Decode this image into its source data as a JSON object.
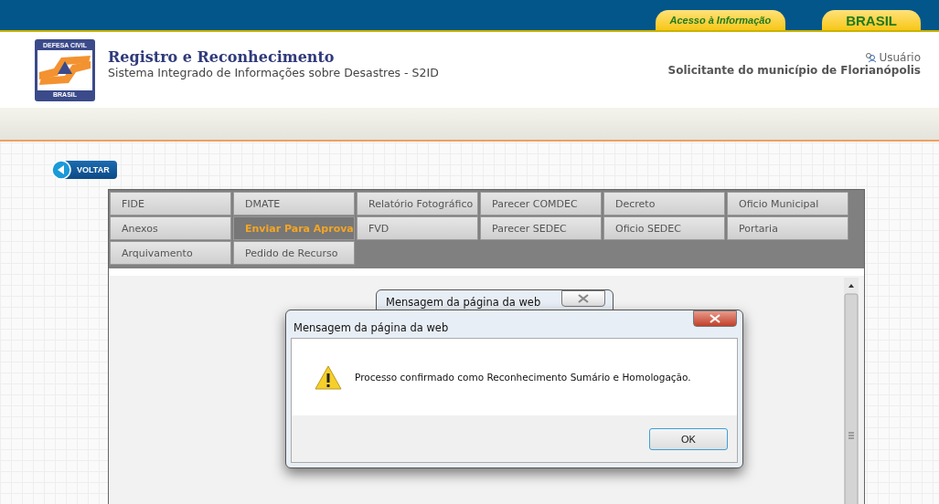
{
  "top_bar": {
    "links": [
      {
        "label": "Acesso à Informação",
        "kind": "access"
      },
      {
        "label": "BRASIL",
        "kind": "brasil"
      }
    ]
  },
  "header": {
    "logo": {
      "top": "DEFESA CIVIL",
      "bottom": "BRASIL"
    },
    "title": "Registro e Reconhecimento",
    "subtitle": "Sistema Integrado de Informações sobre Desastres - S2ID",
    "user_link": "Usuário",
    "user_role": "Solicitante do município de Florianópolis"
  },
  "back_button": {
    "label": "VOLTAR"
  },
  "tabs": [
    {
      "label": "FIDE",
      "selected": false
    },
    {
      "label": "DMATE",
      "selected": false
    },
    {
      "label": "Relatório Fotográfico",
      "selected": false
    },
    {
      "label": "Parecer COMDEC",
      "selected": false
    },
    {
      "label": "Decreto",
      "selected": false
    },
    {
      "label": "Oficio Municipal",
      "selected": false
    },
    {
      "label": "Anexos",
      "selected": false
    },
    {
      "label": "Enviar Para Aprova",
      "selected": true
    },
    {
      "label": "FVD",
      "selected": false
    },
    {
      "label": "Parecer SEDEC",
      "selected": false
    },
    {
      "label": "Oficio SEDEC",
      "selected": false
    },
    {
      "label": "Portaria",
      "selected": false
    },
    {
      "label": "Arquivamento",
      "selected": false
    },
    {
      "label": "Pedido de Recurso",
      "selected": false
    }
  ],
  "background_dialog": {
    "title": "Mensagem da página da web"
  },
  "dialog": {
    "title": "Mensagem da página da web",
    "message": "Processo confirmado como Reconhecimento Sumário e Homologação.",
    "buttons": [
      "OK"
    ]
  }
}
